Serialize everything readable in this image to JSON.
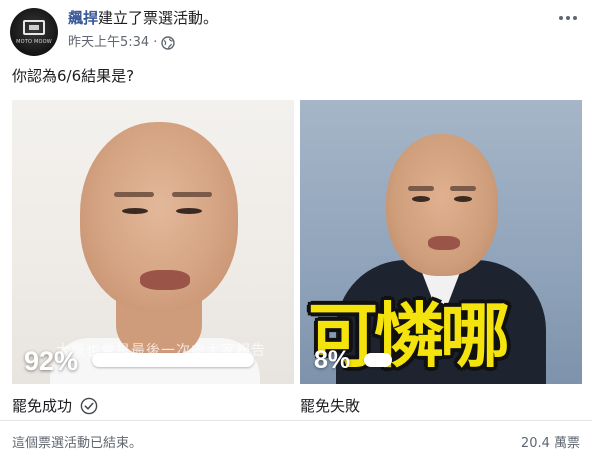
{
  "post": {
    "author": "飆捍",
    "action": "建立了票選活動。",
    "time": "昨天上午5:34",
    "separator": "·",
    "avatar_brand": "MOTO MOOW",
    "question": "你認為6/6結果是?"
  },
  "options": [
    {
      "label": "罷免成功",
      "percent": "92%",
      "fraction": 0.92,
      "selected": true,
      "image_caption": "大概也會是最後一次向大家報告"
    },
    {
      "label": "罷免失敗",
      "percent": "8%",
      "fraction": 0.08,
      "selected": false,
      "image_caption": "可憐哪"
    }
  ],
  "footer": {
    "status": "這個票選活動已結束。",
    "votes": "20.4 萬票"
  },
  "colors": {
    "author_link": "#385898",
    "meta_text": "#616770",
    "overlay_yellow": "#f5e30d"
  },
  "icons": [
    "globe-icon",
    "more-options-icon",
    "check-circle-icon"
  ]
}
